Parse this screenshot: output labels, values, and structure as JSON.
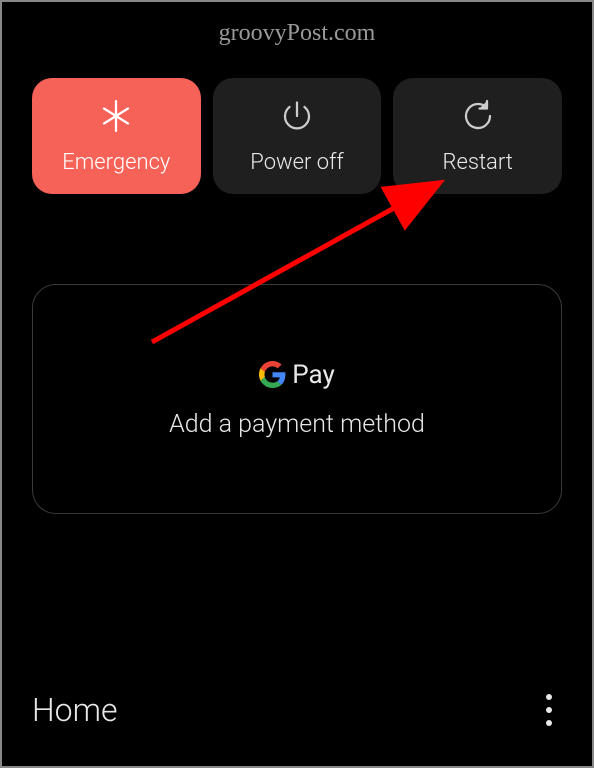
{
  "watermark": "groovyPost.com",
  "powerMenu": {
    "emergency": "Emergency",
    "powerOff": "Power off",
    "restart": "Restart"
  },
  "payCard": {
    "brandText": "Pay",
    "subtitle": "Add a payment method"
  },
  "bottom": {
    "home": "Home"
  }
}
